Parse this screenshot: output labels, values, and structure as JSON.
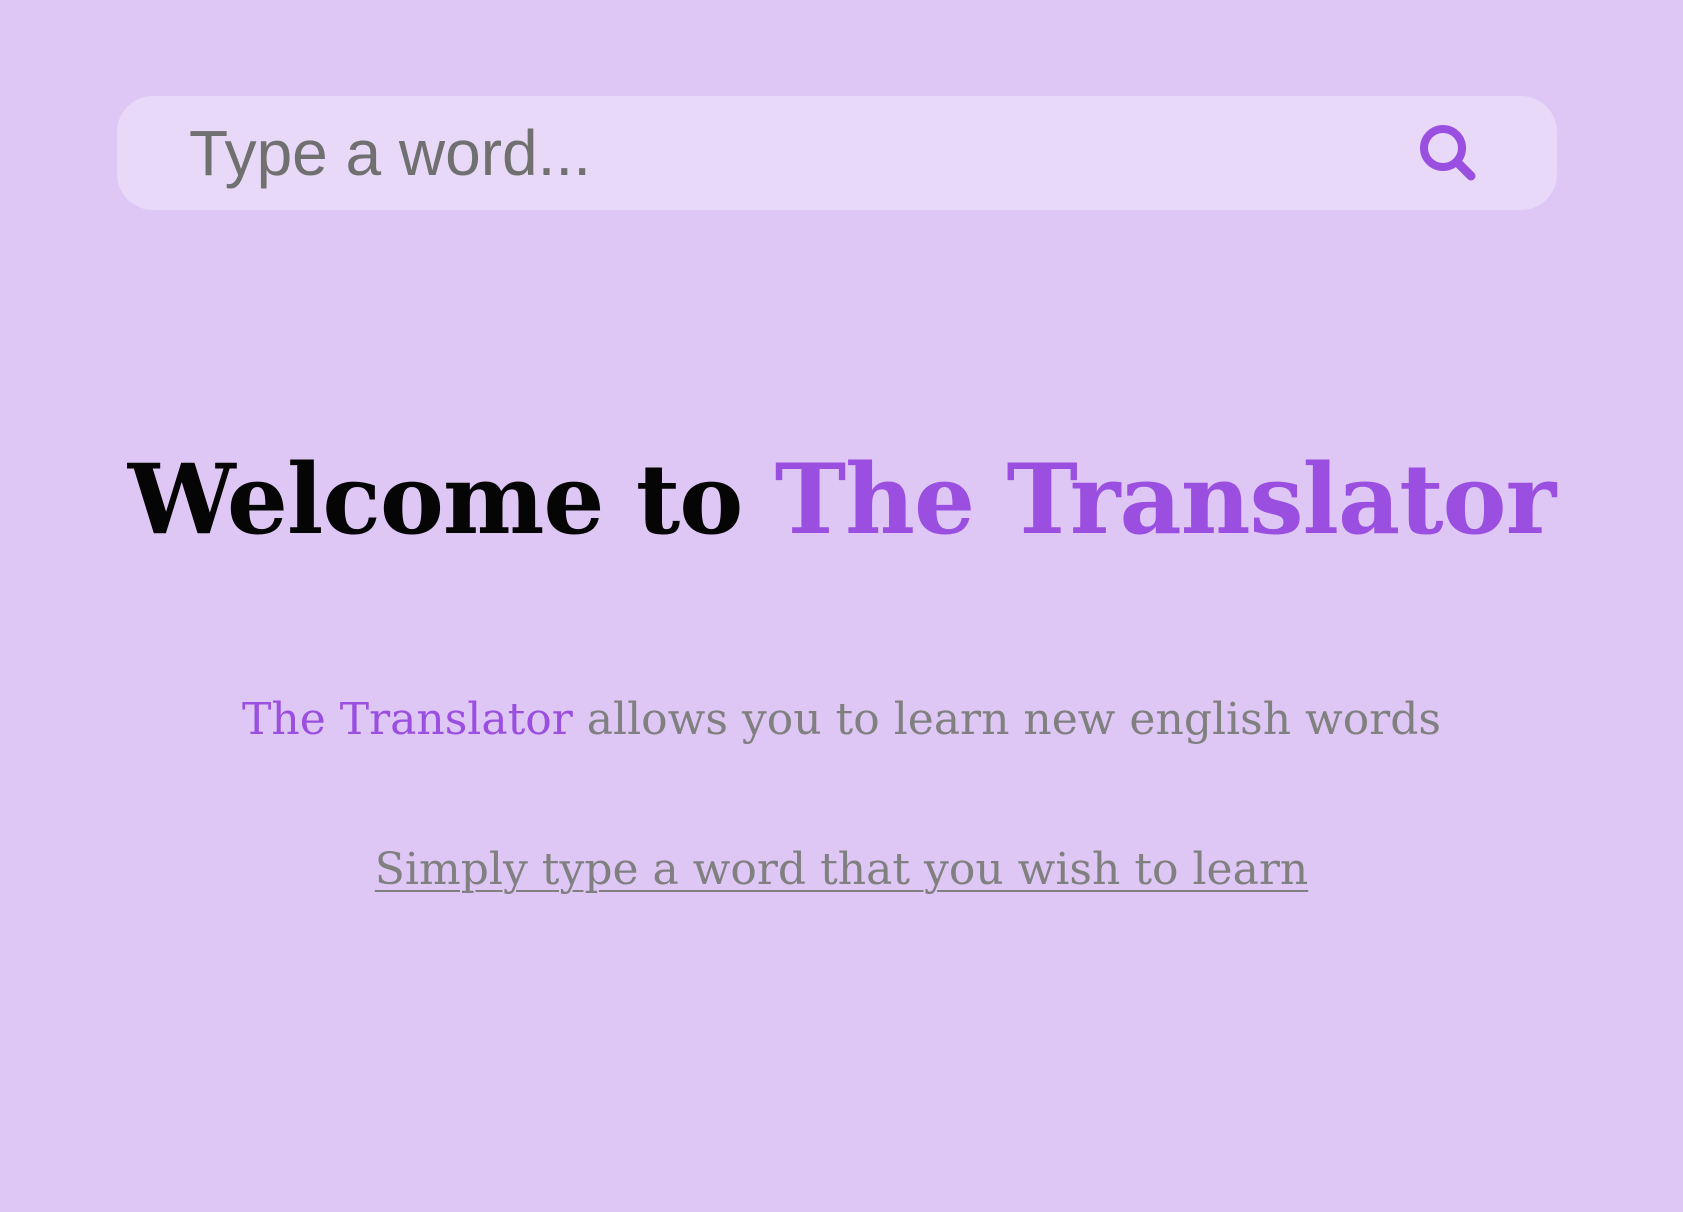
{
  "search": {
    "placeholder": "Type a word...",
    "value": "",
    "icon": "search-icon"
  },
  "hero": {
    "title_prefix": "Welcome to ",
    "title_brand": "The Translator"
  },
  "tagline": {
    "brand": "The Translator",
    "rest": " allows you to learn new english words"
  },
  "instruction": {
    "link_text": "Simply type a word that you wish to learn"
  },
  "colors": {
    "background": "#dec7f4",
    "search_bar": "#e8d9f8",
    "accent": "#9a4fe0",
    "muted_text": "#808080",
    "title_text": "#050505"
  }
}
